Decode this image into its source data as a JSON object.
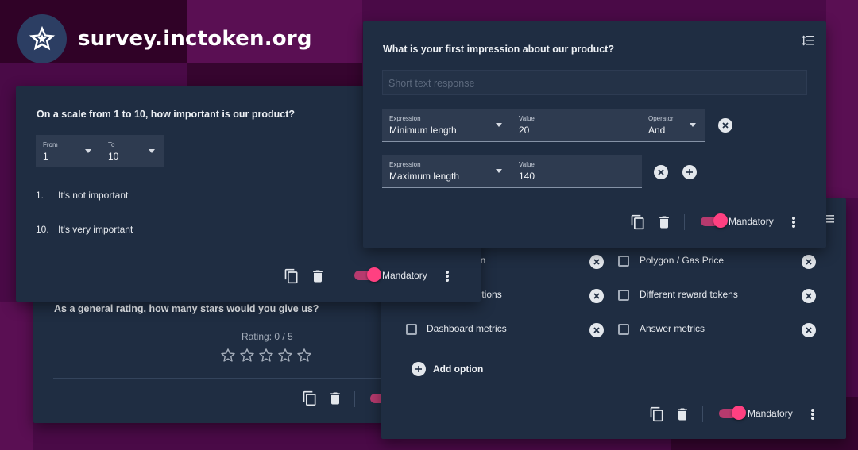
{
  "brand": {
    "domain": "survey.inctoken.org",
    "logo_icon": "star-logo-icon"
  },
  "colors": {
    "background": "#4a0a47",
    "card": "#1f2d42",
    "field": "#2e3b50",
    "accent": "#ff4081"
  },
  "card_rating": {
    "question": "As a general rating, how many stars would you give us?",
    "rating_text": "Rating: 0 / 5",
    "stars_total": 5,
    "stars_filled": 0
  },
  "card_scale": {
    "question": "On a scale from 1 to 10, how important is our product?",
    "from": {
      "label": "From",
      "value": "1"
    },
    "to": {
      "label": "To",
      "value": "10"
    },
    "items": [
      {
        "num": "1.",
        "text": "It's not important"
      },
      {
        "num": "10.",
        "text": "It's very important"
      }
    ],
    "mandatory_label": "Mandatory",
    "mandatory_on": true
  },
  "card_text": {
    "question": "What is your first impression about our product?",
    "placeholder": "Short text response",
    "rule1": {
      "expression": {
        "label": "Expression",
        "value": "Minimum length"
      },
      "value": {
        "label": "Value",
        "value": "20"
      },
      "operator": {
        "label": "Operator",
        "value": "And"
      }
    },
    "rule2": {
      "expression": {
        "label": "Expression",
        "value": "Maximum length"
      },
      "value": {
        "label": "Value",
        "value": "140"
      }
    },
    "mandatory_label": "Mandatory",
    "mandatory_on": true
  },
  "card_options": {
    "left_options": [
      {
        "label": "on"
      },
      {
        "label": "Meta transactions"
      },
      {
        "label": "Dashboard metrics"
      }
    ],
    "right_options": [
      {
        "label": "Polygon / Gas Price"
      },
      {
        "label": "Different reward tokens"
      },
      {
        "label": "Answer metrics"
      }
    ],
    "add_option_label": "Add option",
    "mandatory_label": "Mandatory",
    "mandatory_on": true
  }
}
